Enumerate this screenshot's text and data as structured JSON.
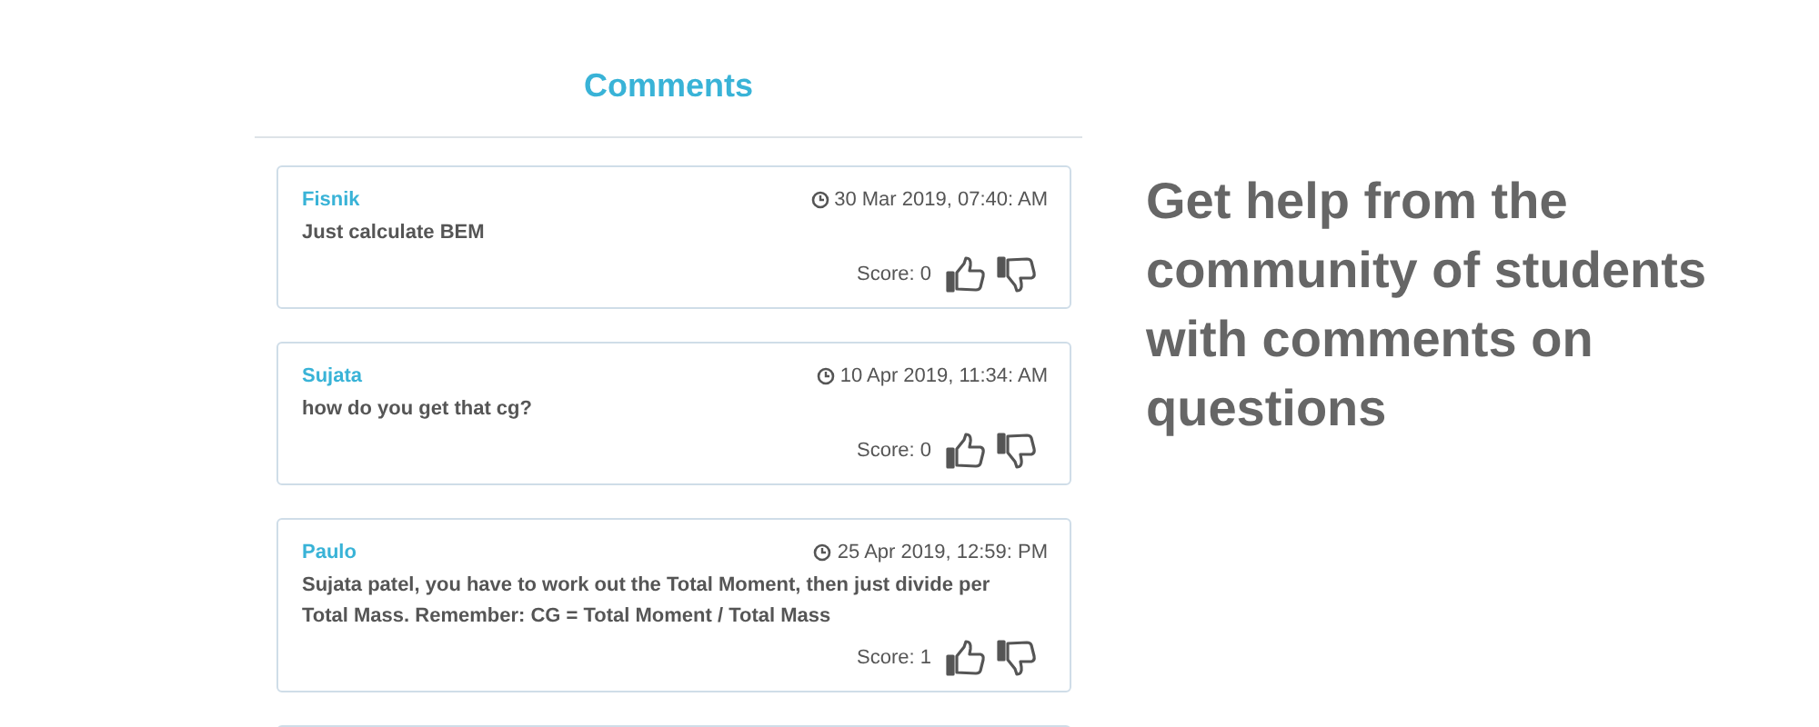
{
  "comments_panel": {
    "title": "Comments",
    "comments": [
      {
        "author": "Fisnik",
        "time": "30 Mar 2019, 07:40: AM",
        "text": "Just calculate BEM",
        "score": "Score: 0"
      },
      {
        "author": "Sujata",
        "time": "10 Apr 2019, 11:34: AM",
        "text": "how do you get that cg?",
        "score": "Score: 0"
      },
      {
        "author": "Paulo",
        "time": "25 Apr 2019, 12:59: PM",
        "text": "Sujata patel, you have to work out the Total Moment, then just divide per Total Mass. Remember: CG = Total Moment / Total Mass",
        "score": "Score: 1"
      }
    ]
  },
  "promo": {
    "headline": "Get help from the community of students with comments on questions"
  }
}
